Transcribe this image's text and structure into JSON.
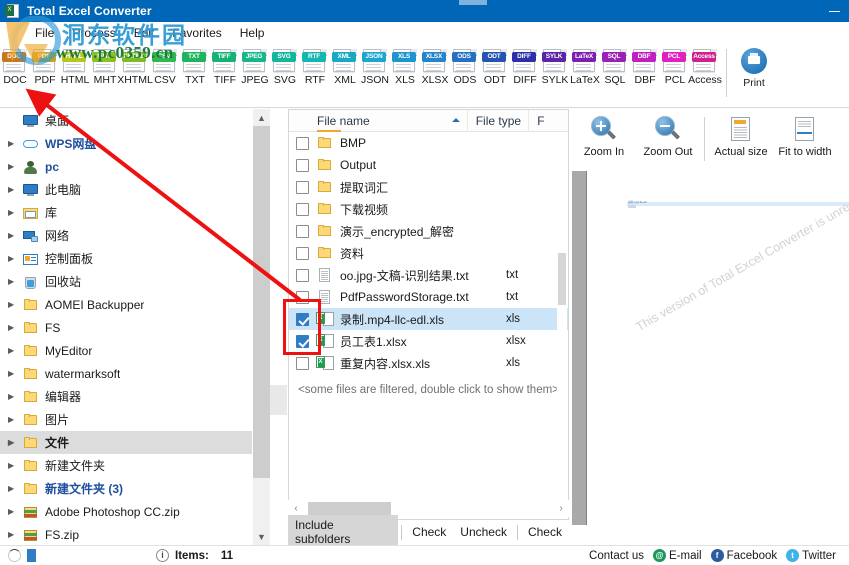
{
  "window": {
    "title": "Total Excel Converter",
    "app_icon": "excel-sheet-icon",
    "xl_label": "X",
    "minimize_label": "–"
  },
  "menu": {
    "items": [
      {
        "label": "File"
      },
      {
        "label": "Process"
      },
      {
        "label": "Edit"
      },
      {
        "label": "Favorites"
      },
      {
        "label": "Help"
      }
    ]
  },
  "watermarks": {
    "site": "www.pc0359.cn",
    "chinese": "洞东软件园",
    "preview_notice": "This version of Total Excel Converter is unregistered."
  },
  "toolbar": {
    "formats": [
      {
        "label": "DOC",
        "tag": "DOC",
        "color": "#c8781c"
      },
      {
        "label": "PDF",
        "tag": "PDF",
        "color": "#c9a21a"
      },
      {
        "label": "HTML",
        "tag": "HTML",
        "color": "#b7c61c"
      },
      {
        "label": "MHT",
        "tag": "MHT",
        "color": "#8cbf20"
      },
      {
        "label": "XHTML",
        "tag": "XHTML",
        "color": "#7dbd23"
      },
      {
        "label": "CSV",
        "tag": "CSV",
        "color": "#2eb94e"
      },
      {
        "label": "TXT",
        "tag": "TXT",
        "color": "#1db45d"
      },
      {
        "label": "TIFF",
        "tag": "TIFF",
        "color": "#16b273"
      },
      {
        "label": "JPEG",
        "tag": "JPEG",
        "color": "#17b58a"
      },
      {
        "label": "SVG",
        "tag": "SVG",
        "color": "#14b59d"
      },
      {
        "label": "RTF",
        "tag": "RTF",
        "color": "#14b6b0"
      },
      {
        "label": "XML",
        "tag": "XML",
        "color": "#18a8c4"
      },
      {
        "label": "JSON",
        "tag": "JSON",
        "color": "#1aa6cf"
      },
      {
        "label": "XLS",
        "tag": "XLS",
        "color": "#1f95cf"
      },
      {
        "label": "XLSX",
        "tag": "XLSX",
        "color": "#2384cc"
      },
      {
        "label": "ODS",
        "tag": "ODS",
        "color": "#2570c4"
      },
      {
        "label": "ODT",
        "tag": "ODT",
        "color": "#2453b5"
      },
      {
        "label": "DIFF",
        "tag": "DIFF",
        "color": "#2b2fa8"
      },
      {
        "label": "SYLK",
        "tag": "SYLK",
        "color": "#5b23a8"
      },
      {
        "label": "LaTeX",
        "tag": "LaTeX",
        "color": "#7c1fb0"
      },
      {
        "label": "SQL",
        "tag": "SQL",
        "color": "#9a20b8"
      },
      {
        "label": "DBF",
        "tag": "DBF",
        "color": "#c020c0"
      },
      {
        "label": "PCL",
        "tag": "PCL",
        "color": "#e020c0"
      },
      {
        "label": "Access",
        "tag": "Access",
        "color": "#d02090"
      }
    ],
    "print_label": "Print",
    "print_icon": "printer-icon"
  },
  "tree": {
    "items": [
      {
        "label": "桌面",
        "icon": "monitor-icon",
        "expandable": false,
        "selected": false,
        "blue": false
      },
      {
        "label": "WPS网盘",
        "icon": "cloud-icon",
        "expandable": true,
        "selected": false,
        "blue": true
      },
      {
        "label": "pc",
        "icon": "user-icon",
        "expandable": true,
        "selected": false,
        "blue": true
      },
      {
        "label": "此电脑",
        "icon": "monitor-icon",
        "expandable": true,
        "selected": false,
        "blue": false
      },
      {
        "label": "库",
        "icon": "library-icon",
        "expandable": true,
        "selected": false,
        "blue": false
      },
      {
        "label": "网络",
        "icon": "network-icon",
        "expandable": true,
        "selected": false,
        "blue": false
      },
      {
        "label": "控制面板",
        "icon": "control-panel-icon",
        "expandable": true,
        "selected": false,
        "blue": false
      },
      {
        "label": "回收站",
        "icon": "recycle-bin-icon",
        "expandable": true,
        "selected": false,
        "blue": false
      },
      {
        "label": "AOMEI Backupper",
        "icon": "folder-icon",
        "expandable": true,
        "selected": false,
        "blue": false
      },
      {
        "label": "FS",
        "icon": "folder-icon",
        "expandable": true,
        "selected": false,
        "blue": false
      },
      {
        "label": "MyEditor",
        "icon": "folder-icon",
        "expandable": true,
        "selected": false,
        "blue": false
      },
      {
        "label": "watermarksoft",
        "icon": "folder-icon",
        "expandable": true,
        "selected": false,
        "blue": false
      },
      {
        "label": "编辑器",
        "icon": "folder-icon",
        "expandable": true,
        "selected": false,
        "blue": false
      },
      {
        "label": "图片",
        "icon": "folder-icon",
        "expandable": true,
        "selected": false,
        "blue": false
      },
      {
        "label": "文件",
        "icon": "folder-icon",
        "expandable": true,
        "selected": true,
        "blue": false
      },
      {
        "label": "新建文件夹",
        "icon": "folder-icon",
        "expandable": true,
        "selected": false,
        "blue": false
      },
      {
        "label": "新建文件夹 (3)",
        "icon": "folder-icon",
        "expandable": true,
        "selected": false,
        "blue": true
      },
      {
        "label": "Adobe Photoshop CC.zip",
        "icon": "zip-icon",
        "expandable": true,
        "selected": false,
        "blue": false
      },
      {
        "label": "FS.zip",
        "icon": "zip-icon",
        "expandable": true,
        "selected": false,
        "blue": false
      }
    ]
  },
  "filelist": {
    "columns": [
      {
        "label": "File name",
        "sorted": "asc"
      },
      {
        "label": "File type"
      },
      {
        "label": "F"
      }
    ],
    "rows": [
      {
        "name": "BMP",
        "type": "",
        "icon": "folder-icon",
        "checked": false,
        "selected": false
      },
      {
        "name": "Output",
        "type": "",
        "icon": "folder-icon",
        "checked": false,
        "selected": false
      },
      {
        "name": "提取词汇",
        "type": "",
        "icon": "folder-icon",
        "checked": false,
        "selected": false
      },
      {
        "name": "下载视频",
        "type": "",
        "icon": "folder-icon",
        "checked": false,
        "selected": false
      },
      {
        "name": "演示_encrypted_解密",
        "type": "",
        "icon": "folder-icon",
        "checked": false,
        "selected": false
      },
      {
        "name": "资料",
        "type": "",
        "icon": "folder-icon",
        "checked": false,
        "selected": false
      },
      {
        "name": "oo.jpg-文稿-识别结果.txt",
        "type": "txt",
        "icon": "text-file-icon",
        "checked": false,
        "selected": false
      },
      {
        "name": "PdfPasswordStorage.txt",
        "type": "txt",
        "icon": "text-file-icon",
        "checked": false,
        "selected": false
      },
      {
        "name": "录制.mp4-llc-edl.xls",
        "type": "xls",
        "icon": "excel-file-icon",
        "checked": true,
        "selected": true
      },
      {
        "name": "员工表1.xlsx",
        "type": "xlsx",
        "icon": "excel-file-icon",
        "checked": true,
        "selected": false
      },
      {
        "name": "重复内容.xlsx.xls",
        "type": "xls",
        "icon": "excel-file-icon",
        "checked": false,
        "selected": false
      }
    ],
    "filtered_note": "<some files are filtered, double click to show them>",
    "buttons": [
      {
        "label": "Include subfolders",
        "active": true
      },
      {
        "label": "Check",
        "active": false
      },
      {
        "label": "Uncheck",
        "active": false
      },
      {
        "label": "Check",
        "active": false
      }
    ]
  },
  "preview": {
    "tools": [
      {
        "label": "Zoom In",
        "icon": "zoom-in-icon"
      },
      {
        "label": "Zoom Out",
        "icon": "zoom-out-icon"
      },
      {
        "label": "Actual size",
        "icon": "actual-size-icon"
      },
      {
        "label": "Fit to width",
        "icon": "fit-to-width-icon"
      }
    ],
    "cell_text": "录制.mp4-llc-edl"
  },
  "status": {
    "items_label": "Items:",
    "items_count": "11",
    "contact_label": "Contact us",
    "links": [
      {
        "label": "E-mail",
        "icon": "email-icon",
        "glyph": "@"
      },
      {
        "label": "Facebook",
        "icon": "facebook-icon",
        "glyph": "f"
      },
      {
        "label": "Twitter",
        "icon": "twitter-icon",
        "glyph": "t"
      }
    ]
  },
  "colors": {
    "titlebar": "#0067b8",
    "accent": "#2f7dc4",
    "selection": "#cce4f7",
    "annotation_red": "#ee1111"
  }
}
